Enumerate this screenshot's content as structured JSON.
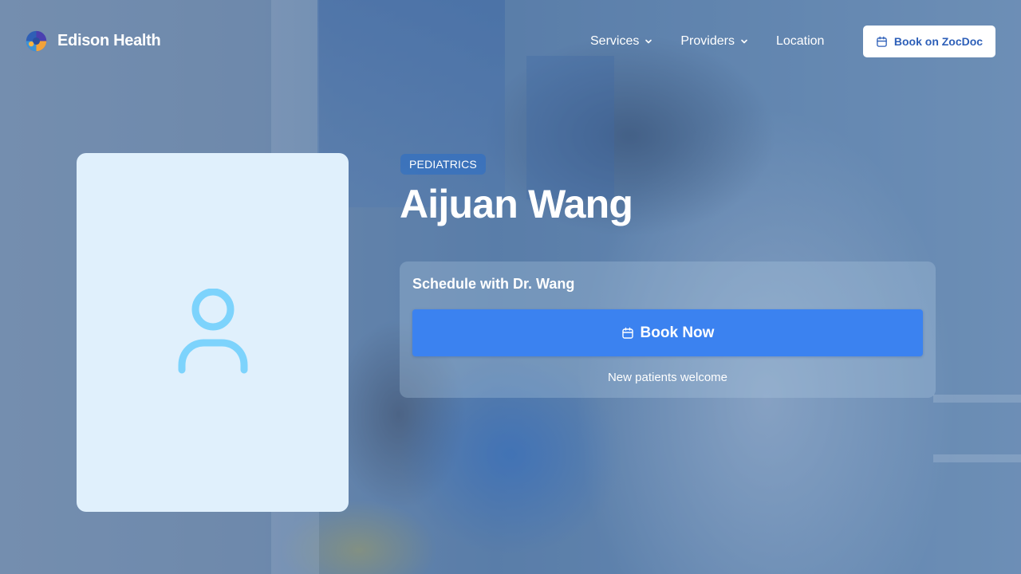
{
  "brand": {
    "name": "Edison Health",
    "logo_icon": "edison-health-logo-icon"
  },
  "nav": {
    "services_label": "Services",
    "providers_label": "Providers",
    "location_label": "Location",
    "zocdoc_label": "Book on ZocDoc"
  },
  "provider": {
    "specialty": "PEDIATRICS",
    "name": "Aijuan Wang",
    "photo_icon": "person-icon"
  },
  "schedule": {
    "title": "Schedule with Dr. Wang",
    "book_label": "Book Now",
    "note": "New patients welcome"
  },
  "colors": {
    "primary": "#3b82f0",
    "accent_text": "#2d5fb8",
    "card_bg": "#e0f0fc",
    "icon": "#7dd3fc"
  }
}
